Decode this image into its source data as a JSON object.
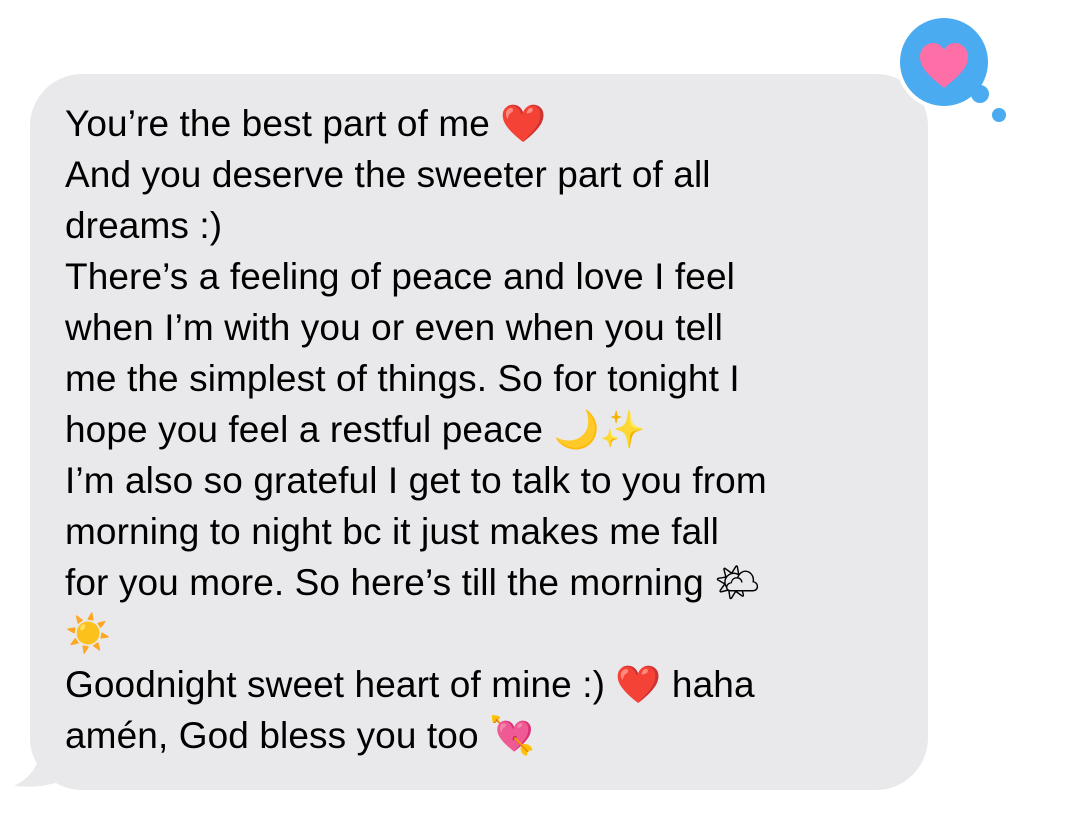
{
  "message": {
    "lines": [
      "You’re the best part of me ❤️",
      "And you deserve the sweeter part of all",
      "dreams :)",
      "There’s a feeling of peace and love I feel",
      "when I’m with you or even when you tell",
      "me the simplest of things. So for tonight I",
      "hope you feel a restful peace 🌙✨",
      "I’m also so grateful I get to talk to you from",
      "morning to night bc it just makes me fall",
      "for you more. So here’s till the morning 🌤",
      "☀️",
      "Goodnight sweet heart of mine :) ❤️ haha",
      "amén, God bless you too 💘"
    ],
    "bubble_color": "#e9e9eb",
    "text_color": "#000000"
  },
  "tapback": {
    "icon": "heart-icon",
    "bubble_color": "#4aabf0",
    "heart_color": "#ff6fa7"
  }
}
